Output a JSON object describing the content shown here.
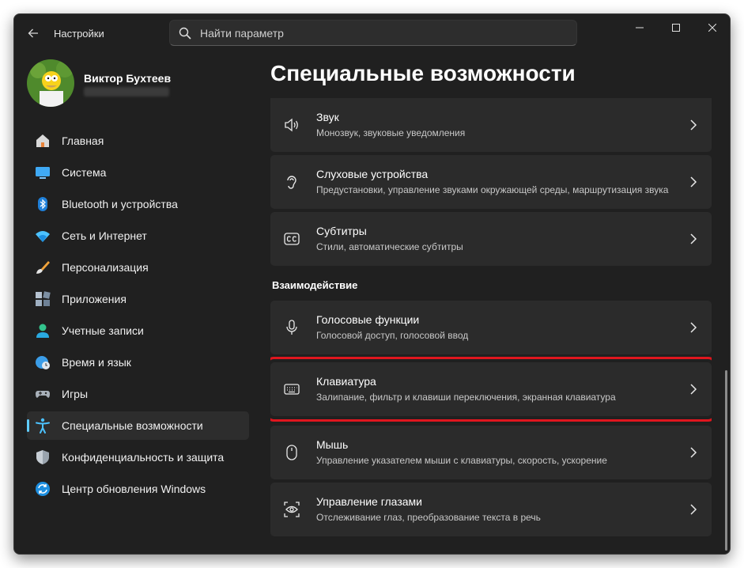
{
  "window": {
    "title": "Настройки",
    "search_placeholder": "Найти параметр"
  },
  "user": {
    "name": "Виктор Бухтеев"
  },
  "sidebar": {
    "items": [
      {
        "label": "Главная",
        "icon": "home-icon"
      },
      {
        "label": "Система",
        "icon": "monitor-icon"
      },
      {
        "label": "Bluetooth и устройства",
        "icon": "bluetooth-icon"
      },
      {
        "label": "Сеть и Интернет",
        "icon": "wifi-icon"
      },
      {
        "label": "Персонализация",
        "icon": "brush-icon"
      },
      {
        "label": "Приложения",
        "icon": "apps-icon"
      },
      {
        "label": "Учетные записи",
        "icon": "person-icon"
      },
      {
        "label": "Время и язык",
        "icon": "globe-clock-icon"
      },
      {
        "label": "Игры",
        "icon": "gamepad-icon"
      },
      {
        "label": "Специальные возможности",
        "icon": "accessibility-icon",
        "active": true
      },
      {
        "label": "Конфиденциальность и защита",
        "icon": "shield-icon"
      },
      {
        "label": "Центр обновления Windows",
        "icon": "update-icon"
      }
    ]
  },
  "main": {
    "title": "Специальные возможности",
    "section_interaction": "Взаимодействие",
    "cards": [
      {
        "title": "Звук",
        "subtitle": "Монозвук, звуковые уведомления",
        "icon": "speaker-icon"
      },
      {
        "title": "Слуховые устройства",
        "subtitle": "Предустановки, управление звуками окружающей среды, маршрутизация звука",
        "icon": "hearing-icon"
      },
      {
        "title": "Субтитры",
        "subtitle": "Стили, автоматические субтитры",
        "icon": "cc-icon"
      },
      {
        "title": "Голосовые функции",
        "subtitle": "Голосовой доступ, голосовой ввод",
        "icon": "microphone-icon"
      },
      {
        "title": "Клавиатура",
        "subtitle": "Залипание, фильтр и клавиши переключения, экранная клавиатура",
        "icon": "keyboard-icon",
        "highlighted": true
      },
      {
        "title": "Мышь",
        "subtitle": "Управление указателем мыши с клавиатуры, скорость, ускорение",
        "icon": "mouse-icon"
      },
      {
        "title": "Управление глазами",
        "subtitle": "Отслеживание глаз, преобразование текста в речь",
        "icon": "eye-control-icon"
      }
    ]
  },
  "colors": {
    "accent": "#60cdff",
    "highlight_frame": "#e0161e",
    "window_bg": "#202020",
    "card_bg": "#2b2b2b"
  }
}
